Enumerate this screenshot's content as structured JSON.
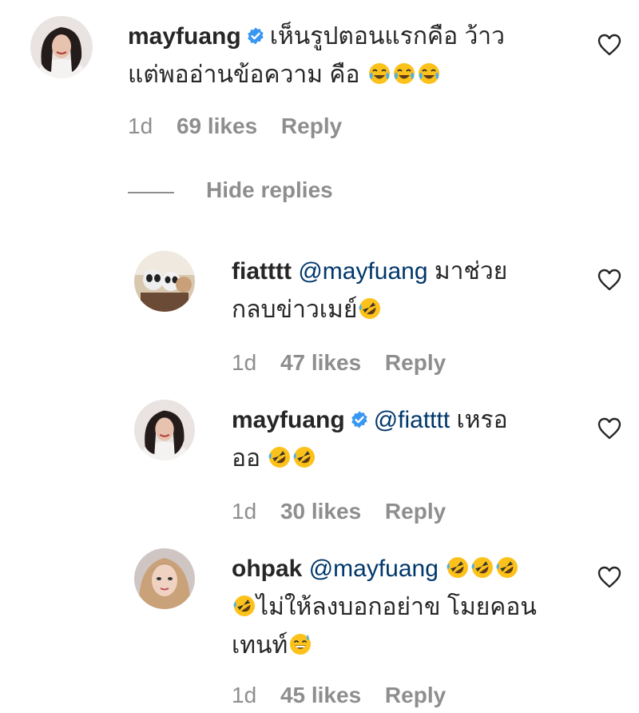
{
  "comments": [
    {
      "username": "mayfuang",
      "verified": true,
      "mention": "",
      "text_line1": "เห็นรูปตอนแรกคือ ว้าว",
      "text_line2": "แต่พออ่านข้อความ คือ",
      "emoji": "face-with-tears-of-joy",
      "time": "1d",
      "likes": "69 likes",
      "reply": "Reply"
    },
    {
      "username": "fiatttt",
      "verified": false,
      "mention": "@mayfuang",
      "text_line1": "มาช่วย",
      "text_line2": "กลบข่าวเมย์",
      "emoji": "rolling-on-the-floor-laughing",
      "time": "1d",
      "likes": "47 likes",
      "reply": "Reply"
    },
    {
      "username": "mayfuang",
      "verified": true,
      "mention": "@fiatttt",
      "text_line1": "เหรอ",
      "text_line2": "ออ",
      "emoji": "rolling-on-the-floor-laughing",
      "time": "1d",
      "likes": "30 likes",
      "reply": "Reply"
    },
    {
      "username": "ohpak",
      "verified": false,
      "mention": "@mayfuang",
      "text_line1": "",
      "text_line2": "ไม่ให้ลงบอกอย่าข โมยคอน",
      "text_line3": "เทนท์",
      "emoji": "rolling-on-the-floor-laughing",
      "emoji_end": "grinning-face-with-sweat",
      "time": "1d",
      "likes": "45 likes",
      "reply": "Reply"
    }
  ],
  "hide_replies": "Hide replies",
  "colors": {
    "text": "#262626",
    "secondary": "#8e8e8e",
    "mention": "#00376b",
    "verified": "#3897f0"
  },
  "icons": {
    "like": "heart-outline-icon",
    "verified": "verified-badge-icon"
  }
}
